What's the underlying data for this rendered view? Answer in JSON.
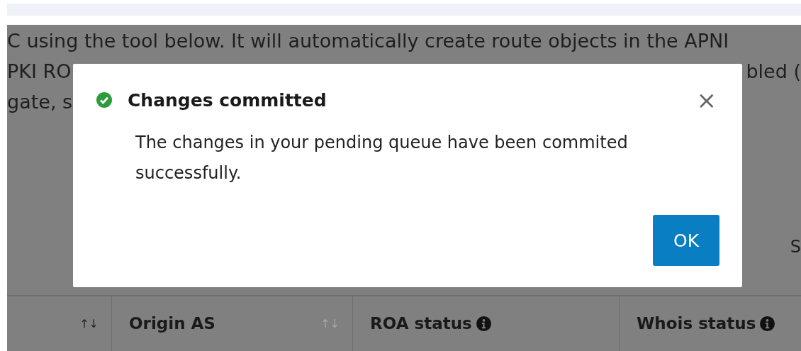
{
  "background_text": [
    {
      "left": "C using the tool below. It will automatically create route objects in the APNI"
    },
    {
      "left": "PKI RO",
      "right": "bled ("
    },
    {
      "left": "gate, s"
    }
  ],
  "side_text": "S",
  "table": {
    "columns": [
      {
        "sort": "↑↓",
        "sort_active": true
      },
      {
        "label": "Origin AS",
        "sort": "↑↓",
        "sort_active": false
      },
      {
        "label": "ROA status",
        "info": true
      },
      {
        "label": "Whois status",
        "info": true
      }
    ]
  },
  "dialog": {
    "title": "Changes committed",
    "message": "The changes in your pending queue have been commited successfully.",
    "close": "×",
    "ok": "OK"
  }
}
